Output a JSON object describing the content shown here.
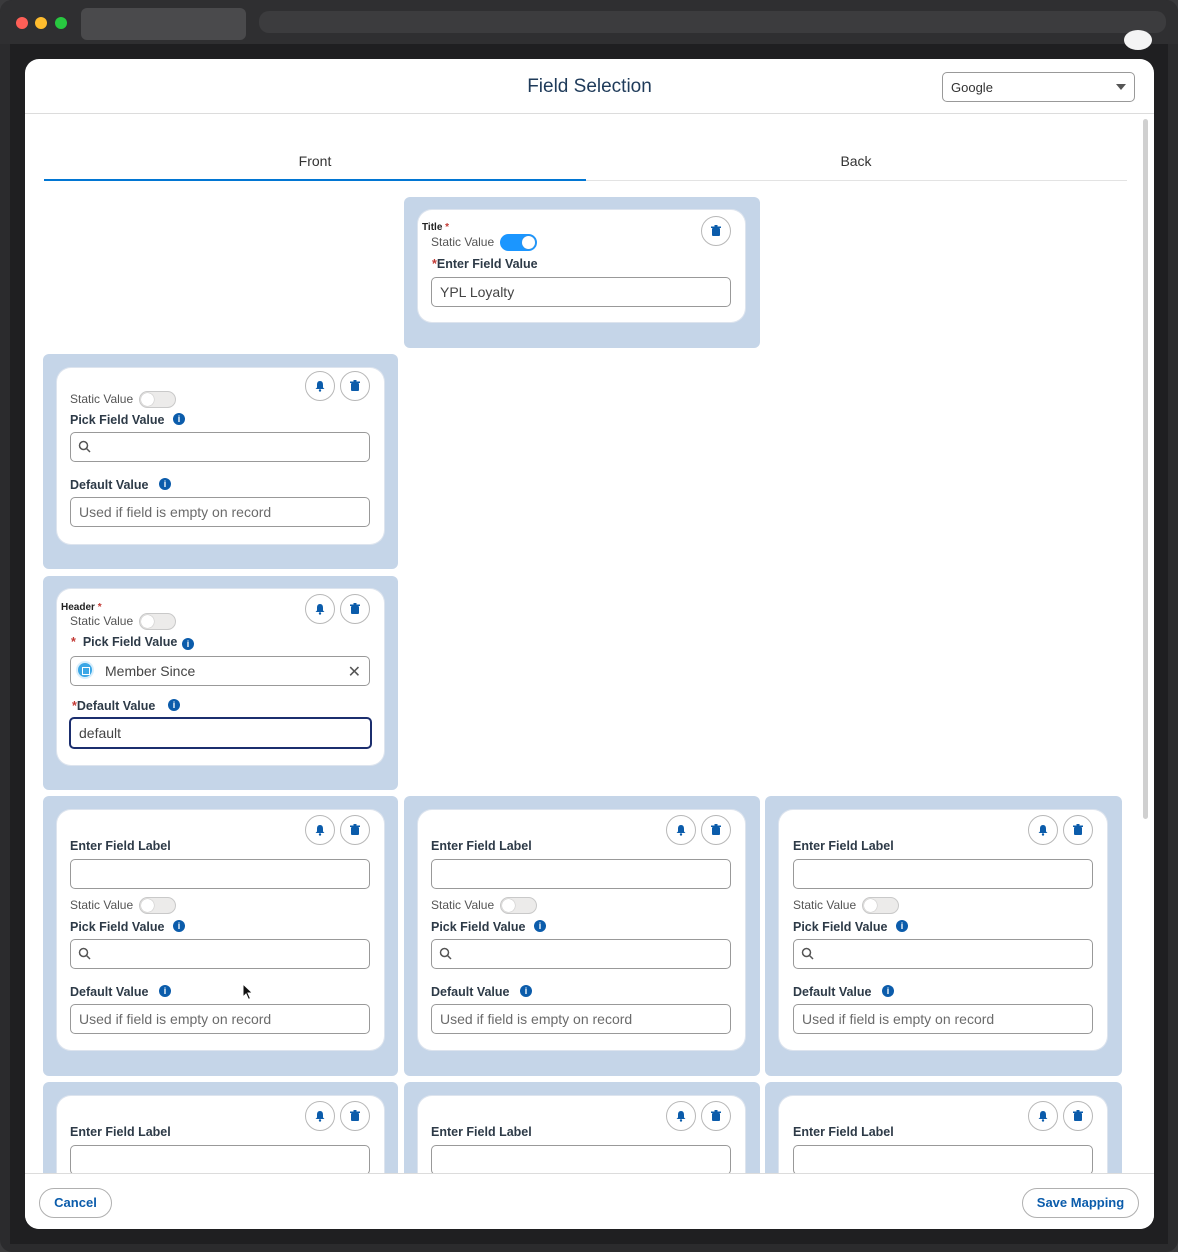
{
  "modal": {
    "title": "Field Selection",
    "provider_select": "Google"
  },
  "tabs": {
    "front": "Front",
    "back": "Back"
  },
  "labels": {
    "title": "Title",
    "header": "Header",
    "static_value": "Static Value",
    "enter_field_value": "Enter Field Value",
    "pick_field_value": "Pick Field Value",
    "default_value": "Default Value",
    "enter_field_label": "Enter Field Label",
    "default_placeholder": "Used if field is empty on record",
    "required_mark": "*"
  },
  "title_card": {
    "value": "YPL Loyalty",
    "static_on": true
  },
  "header_card": {
    "picked_field": "Member Since",
    "default_value": "default"
  },
  "footer": {
    "cancel": "Cancel",
    "save": "Save Mapping"
  },
  "icons": [
    "bell-icon",
    "trash-icon",
    "search-icon",
    "info-icon",
    "close-icon",
    "field-icon",
    "caret-down-icon"
  ],
  "colors": {
    "accent": "#0176d3",
    "panel": "#c5d5e8",
    "toggle_on": "#1b96ff"
  }
}
